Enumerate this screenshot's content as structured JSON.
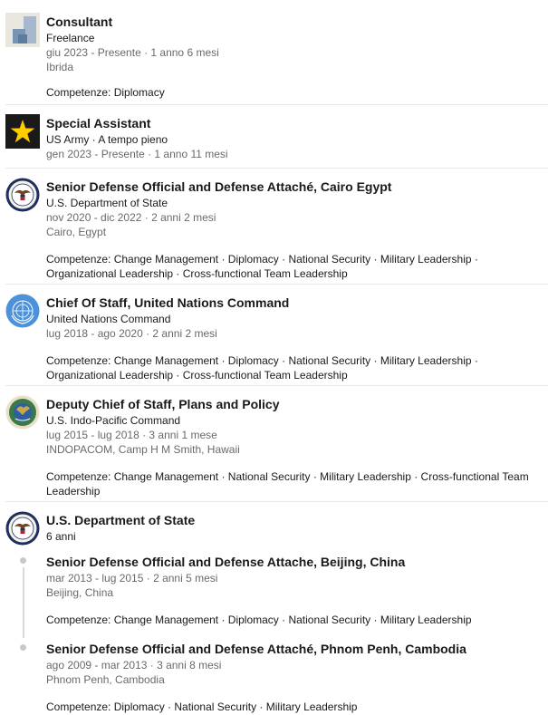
{
  "experiences": [
    {
      "title": "Consultant",
      "company": "Freelance",
      "dates": "giu 2023 - Presente · 1 anno 6 mesi",
      "location": "Ibrida",
      "skills": "Competenze: Diplomacy",
      "logo": "placeholder-company-icon"
    },
    {
      "title": "Special Assistant",
      "company": "US Army · A tempo pieno",
      "dates": "gen 2023 - Presente · 1 anno 11 mesi",
      "logo": "army-star-icon"
    },
    {
      "title": "Senior Defense Official and Defense Attaché, Cairo Egypt",
      "company": "U.S. Department of State",
      "dates": "nov 2020 - dic 2022 · 2 anni 2 mesi",
      "location": "Cairo, Egypt",
      "skills": "Competenze: Change Management · Diplomacy · National Security · Military Leadership · Organizational Leadership · Cross-functional Team Leadership",
      "logo": "state-dept-seal-icon"
    },
    {
      "title": "Chief Of Staff, United Nations Command",
      "company": "United Nations Command",
      "dates": "lug 2018 - ago 2020 · 2 anni 2 mesi",
      "skills": "Competenze: Change Management · Diplomacy · National Security · Military Leadership · Organizational Leadership · Cross-functional Team Leadership",
      "logo": "un-emblem-icon"
    },
    {
      "title": "Deputy Chief of Staff, Plans and Policy",
      "company": "U.S. Indo-Pacific Command",
      "dates": "lug 2015 - lug 2018 · 3 anni 1 mese",
      "location": "INDOPACOM, Camp H M Smith, Hawaii",
      "skills": "Competenze: Change Management · National Security · Military Leadership · Cross-functional Team Leadership",
      "logo": "indopacom-seal-icon"
    }
  ],
  "group": {
    "company": "U.S. Department of State",
    "duration": "6 anni",
    "logo": "state-dept-seal-icon",
    "roles": [
      {
        "title": "Senior Defense Official and Defense Attache, Beijing, China",
        "dates": "mar 2013 - lug 2015 · 2 anni 5 mesi",
        "location": "Beijing, China",
        "skills": "Competenze: Change Management · Diplomacy · National Security · Military Leadership"
      },
      {
        "title": "Senior Defense Official and Defense Attaché, Phnom Penh, Cambodia",
        "dates": "ago 2009 - mar 2013 · 3 anni 8 mesi",
        "location": "Phnom Penh, Cambodia",
        "skills": "Competenze: Diplomacy · National Security · Military Leadership"
      }
    ]
  },
  "colors": {
    "text": "#191919",
    "meta": "#666666",
    "divider": "#e8e8e8",
    "army": "#1a1a1a",
    "army_star": "#ffcc00",
    "state_blue": "#1d2f5c",
    "un_blue": "#4b92db"
  }
}
